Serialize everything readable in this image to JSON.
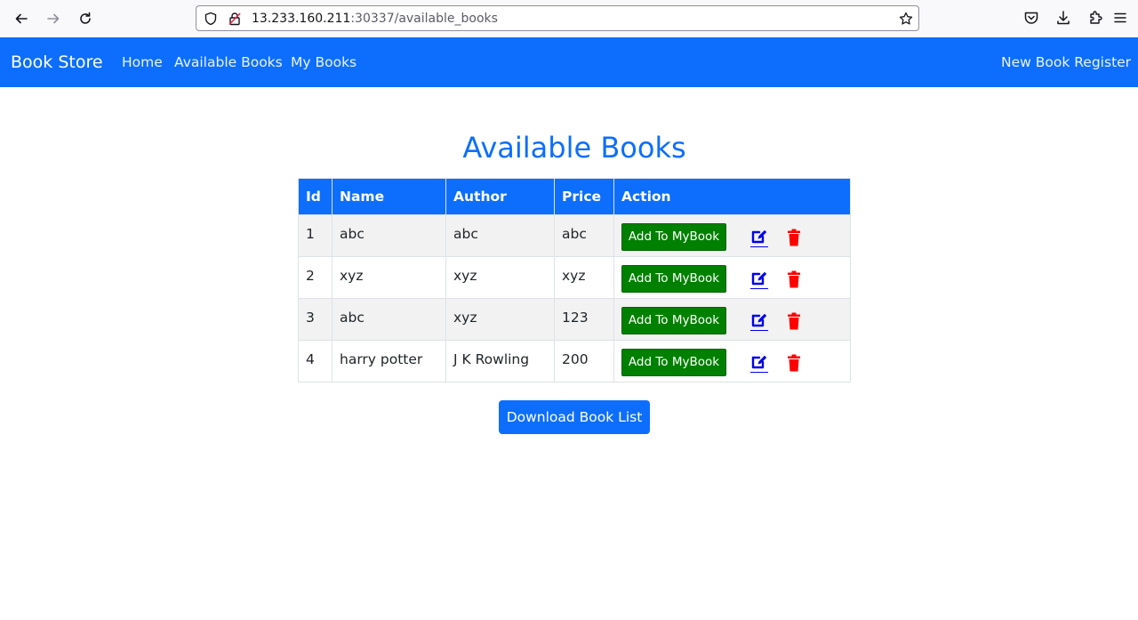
{
  "browser": {
    "url_host": "13.233.160.211",
    "url_rest": ":30337/available_books"
  },
  "navbar": {
    "brand": "Book Store",
    "links": [
      "Home",
      "Available Books",
      "My Books"
    ],
    "right_link": "New Book Register"
  },
  "page": {
    "title": "Available Books",
    "download_label": "Download Book List"
  },
  "table": {
    "headers": [
      "Id",
      "Name",
      "Author",
      "Price",
      "Action"
    ],
    "add_label": "Add To MyBook",
    "rows": [
      {
        "id": "1",
        "name": "abc",
        "author": "abc",
        "price": "abc"
      },
      {
        "id": "2",
        "name": "xyz",
        "author": "xyz",
        "price": "xyz"
      },
      {
        "id": "3",
        "name": "abc",
        "author": "xyz",
        "price": "123"
      },
      {
        "id": "4",
        "name": "harry potter",
        "author": "J K Rowling",
        "price": "200"
      }
    ]
  },
  "colors": {
    "primary": "#0d6efd",
    "add_button": "#008000",
    "edit_icon": "#0000ee",
    "delete_icon": "#ff0000"
  },
  "icons": {
    "edit": "pencil-square-icon",
    "delete": "trash-icon"
  }
}
